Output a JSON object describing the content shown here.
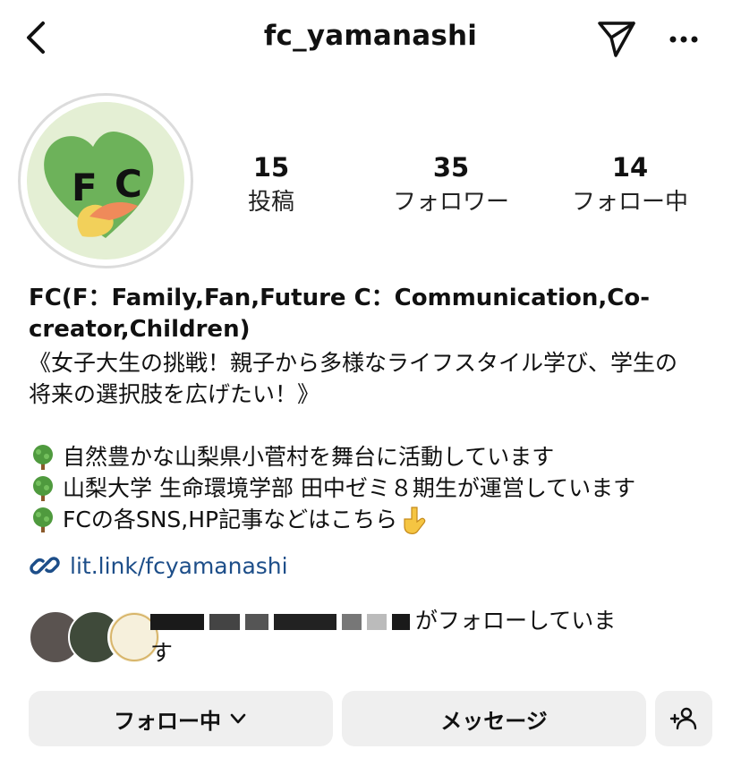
{
  "header": {
    "username": "fc_yamanashi"
  },
  "avatar": {
    "logo_text": "F C"
  },
  "stats": [
    {
      "value": "15",
      "label": "投稿"
    },
    {
      "value": "35",
      "label": "フォロワー"
    },
    {
      "value": "14",
      "label": "フォロー中"
    }
  ],
  "profile": {
    "name_line1": "FC(F：Family,Fan,Future  C：Communication,Co-",
    "name_line2": "creator,Children)",
    "bio_line1": "《女子大生の挑戦！親子から多様なライフスタイル学び、学生の",
    "bio_line2": "将来の選択肢を広げたい！》",
    "bullet1": "自然豊かな山梨県小菅村を舞台に活動しています",
    "bullet2": "山梨大学 生命環境学部 田中ゼミ８期生が運営しています",
    "bullet3": "FCの各SNS,HP記事などはこちら",
    "link": "lit.link/fcyamanashi"
  },
  "followed_by": {
    "suffix1": "がフォローしていま",
    "suffix2": "す"
  },
  "buttons": {
    "following": "フォロー中",
    "message": "メッセージ"
  },
  "colors": {
    "link": "#1d4e89",
    "button_bg": "#efefef"
  }
}
